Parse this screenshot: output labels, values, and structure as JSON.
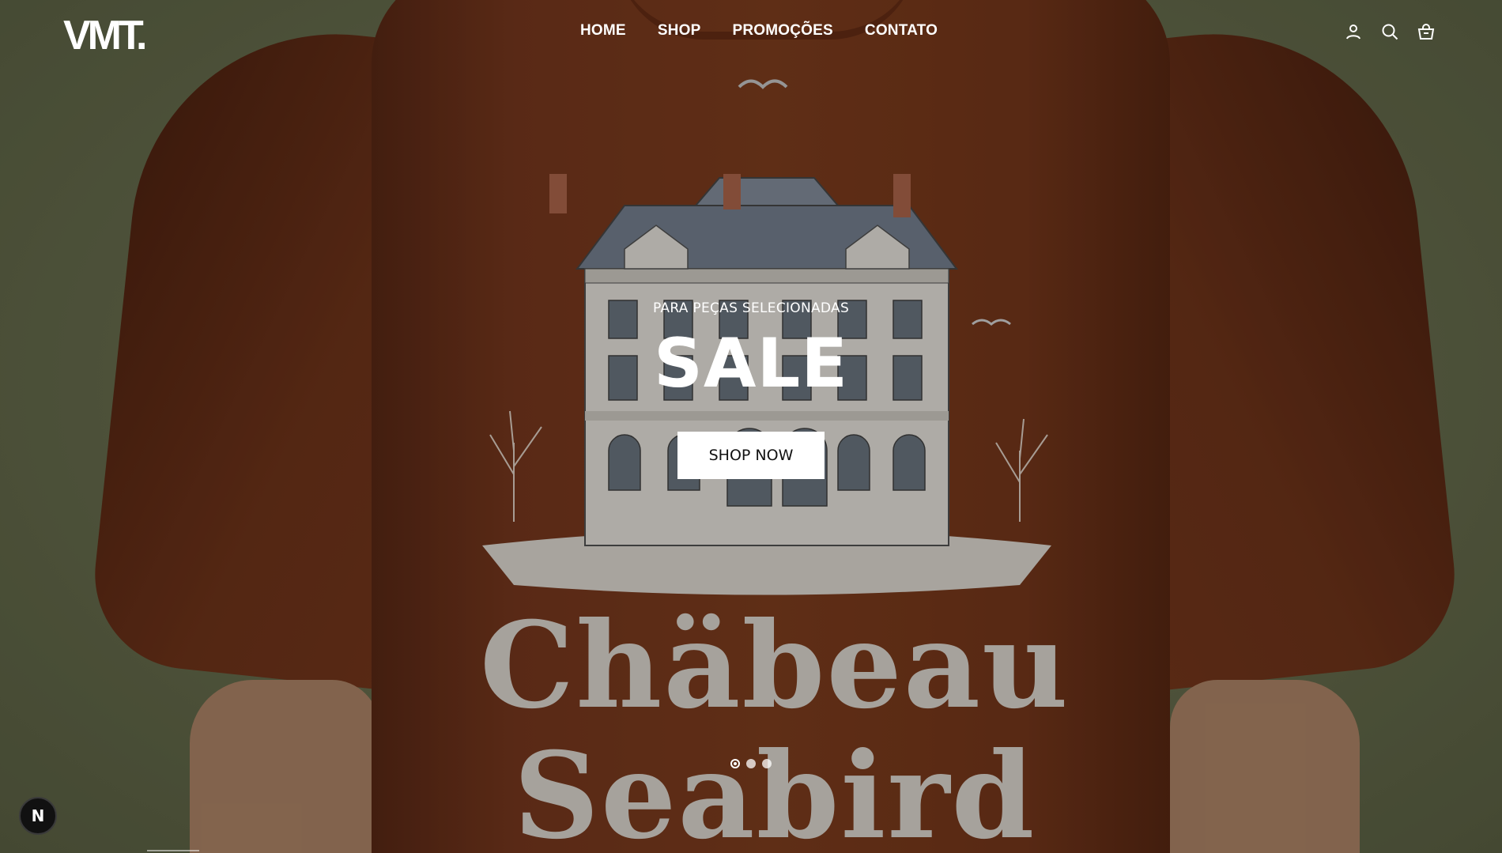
{
  "header": {
    "logo": "VMT.",
    "nav": [
      {
        "label": "HOME"
      },
      {
        "label": "SHOP"
      },
      {
        "label": "PROMOÇÕES"
      },
      {
        "label": "CONTATO"
      }
    ],
    "icons": [
      "user-icon",
      "search-icon",
      "bag-icon"
    ]
  },
  "hero": {
    "background_image": "Back of a rust-brown t-shirt with a mansion illustration print",
    "print_text": [
      "Chäbeau",
      "Seabird"
    ],
    "subtitle": "PARA PEÇAS SELECIONADAS",
    "headline": "SALE",
    "cta_label": "SHOP NOW",
    "slides_total": 3,
    "active_slide": 1
  },
  "dev_badge": {
    "label": "N"
  },
  "colors": {
    "shirt": "#7c3a1f",
    "background": "#6f7552",
    "text": "#ffffff",
    "button_bg": "#ffffff",
    "button_text": "#111111"
  }
}
